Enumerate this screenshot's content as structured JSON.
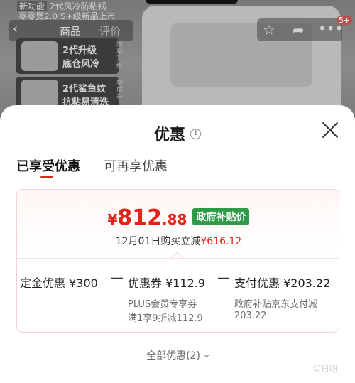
{
  "background": {
    "line1_tag": "新功能",
    "line1_text": "2代风冷防粘锅",
    "line2_text": "零零煲2.0 S+级新品上市",
    "nav_back": "‹",
    "nav_tab1": "商品",
    "nav_tab2": "评价",
    "feature_cards": [
      {
        "line1": "2代升级",
        "line2": "底仓风冷",
        "side": "防粘升级"
      },
      {
        "line1": "2代鲨鱼纹",
        "line2": "抗粘易清洗",
        "side": "材质升"
      }
    ],
    "icons": [
      "star-icon",
      "share-icon",
      "more-icon"
    ],
    "badge": "5+"
  },
  "sheet": {
    "title": "优惠",
    "info_glyph": "i",
    "tabs": [
      "已享受优惠",
      "可再享优惠"
    ],
    "price": {
      "symbol": "¥",
      "integer": "812",
      "decimal": ".88",
      "badge": "政府补贴价",
      "buy_prefix": "12月01日购买立减",
      "buy_amount": "¥616.12"
    },
    "breakdown": [
      {
        "label": "定金优惠 ¥300",
        "desc": []
      },
      {
        "label": "优惠券 ¥112.9",
        "desc": [
          "PLUS会员专享券",
          "满1享9折减112.9"
        ]
      },
      {
        "label": "支付优惠 ¥203.22",
        "desc": [
          "政府补贴京东支付减",
          "203.22"
        ]
      }
    ],
    "operator": "—",
    "all_offers": "全部优惠(2)",
    "watermark": "买日呀"
  },
  "colors": {
    "accent_red": "#e2231a",
    "badge_green": "#2f9a47",
    "tab_underline": "#e2231a"
  }
}
